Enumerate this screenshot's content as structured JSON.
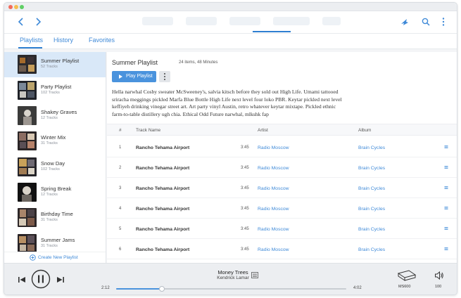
{
  "tabs": [
    {
      "label": "Playlists",
      "active": true
    },
    {
      "label": "History",
      "active": false
    },
    {
      "label": "Favorites",
      "active": false
    }
  ],
  "playlist": {
    "title": "Summer Playlist",
    "count": "24 items, 48 Minutes",
    "play_label": "Play Playlist",
    "description": "Hella narwhal Cosby sweater McSweeney's, salvia kitsch before they sold out High Life. Umami tattooed sriracha meggings pickled Marfa Blue Bottle High Life next level four loko PBR. Keytar pickled next level keffiyeh drinking vinegar street art. Art party vinyl Austin, retro whatever keytar mixtape. Pickled ethnic farm-to-table distillery ugh chia. Ethical Odd Future narwhal, mlkshk fap"
  },
  "sidebar": {
    "items": [
      {
        "name": "Summer Playlist",
        "tracks": "52 Tracks",
        "selected": true
      },
      {
        "name": "Party Playlist",
        "tracks": "102 Tracks",
        "selected": false
      },
      {
        "name": "Shakey Graves",
        "tracks": "12 Tracks",
        "selected": false
      },
      {
        "name": "Winter Mix",
        "tracks": "31 Tracks",
        "selected": false
      },
      {
        "name": "Snow Day",
        "tracks": "102 Tracks",
        "selected": false
      },
      {
        "name": "Spring Break",
        "tracks": "12 Tracks",
        "selected": false
      },
      {
        "name": "Birthday Time",
        "tracks": "31 Tracks",
        "selected": false
      },
      {
        "name": "Summer Jams",
        "tracks": "31 Tracks",
        "selected": false
      }
    ],
    "create_label": "Create New Playlist"
  },
  "table": {
    "headers": {
      "num": "#",
      "name": "Track Name",
      "artist": "Artist",
      "album": "Album"
    },
    "rows": [
      {
        "num": "1",
        "name": "Rancho Tehama Airport",
        "duration": "3:45",
        "artist": "Radio Moscow",
        "album": "Brain Cycles"
      },
      {
        "num": "2",
        "name": "Rancho Tehama Airport",
        "duration": "3:45",
        "artist": "Radio Moscow",
        "album": "Brain Cycles"
      },
      {
        "num": "3",
        "name": "Rancho Tehama Airport",
        "duration": "3:45",
        "artist": "Radio Moscow",
        "album": "Brain Cycles"
      },
      {
        "num": "4",
        "name": "Rancho Tehama Airport",
        "duration": "3:45",
        "artist": "Radio Moscow",
        "album": "Brain Cycles"
      },
      {
        "num": "5",
        "name": "Rancho Tehama Airport",
        "duration": "3:45",
        "artist": "Radio Moscow",
        "album": "Brain Cycles"
      },
      {
        "num": "6",
        "name": "Rancho Tehama Airport",
        "duration": "3:45",
        "artist": "Radio Moscow",
        "album": "Brain Cycles"
      }
    ]
  },
  "player": {
    "song": "Money Trees",
    "artist": "Kendrick Lamar",
    "current_time": "2:12",
    "total_time": "4:02",
    "progress": 0.2,
    "device": "MS600",
    "volume": "100"
  },
  "colors": {
    "accent": "#2e7fd1",
    "link": "#3f8ad8",
    "selected_bg": "#d9e8f8",
    "button": "#4a93dd"
  },
  "icons": {
    "back": "chevron-left-icon",
    "forward": "chevron-right-icon",
    "cast": "cast-icon",
    "search": "search-icon",
    "more": "more-vertical-icon",
    "prev": "skip-back-icon",
    "pause": "pause-icon",
    "next": "skip-forward-icon",
    "device": "speaker-device-icon",
    "volume": "volume-icon"
  }
}
